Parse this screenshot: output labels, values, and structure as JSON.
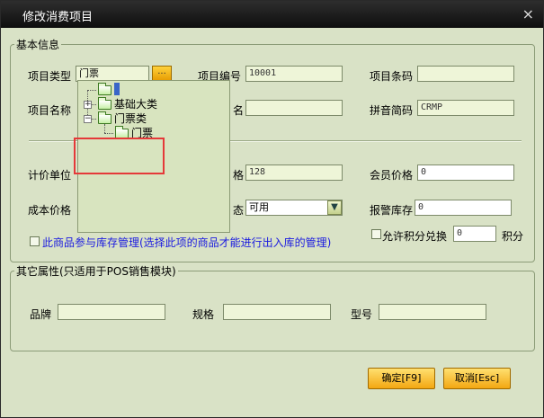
{
  "window": {
    "title": "修改消费项目",
    "close_glyph": "×"
  },
  "basic_info": {
    "legend": "基本信息",
    "item_type": {
      "label": "项目类型",
      "value": "门票",
      "button": "..."
    },
    "item_code": {
      "label": "项目编号",
      "value": "10001"
    },
    "item_barcode": {
      "label": "项目条码",
      "value": ""
    },
    "item_name": {
      "label": "项目名称",
      "hidden_label_tail": "名",
      "value": ""
    },
    "pinyin_code": {
      "label": "拼音简码",
      "value": "CRMP"
    },
    "unit": {
      "label": "计价单位"
    },
    "price": {
      "label_tail": "格",
      "value": "128"
    },
    "member_price": {
      "label": "会员价格",
      "value": "0"
    },
    "cost_price": {
      "label": "成本价格"
    },
    "status": {
      "label_tail": "态",
      "value": "可用"
    },
    "alert_stock": {
      "label": "报警库存",
      "value": "0"
    },
    "stock_manage": {
      "label": "此商品参与库存管理(选择此项的商品才能进行出入库的管理)"
    },
    "points": {
      "label": "允许积分兑换",
      "value": "0",
      "unit": "积分"
    }
  },
  "other_attrs": {
    "legend": "其它属性(只适用于POS销售模块)",
    "brand": {
      "label": "品牌",
      "value": ""
    },
    "spec": {
      "label": "规格",
      "value": ""
    },
    "model": {
      "label": "型号",
      "value": ""
    }
  },
  "buttons": {
    "ok": "确定[F9]",
    "cancel": "取消[Esc]"
  },
  "tree": {
    "root": "",
    "items": [
      {
        "label": "基础大类",
        "toggle": "+"
      },
      {
        "label": "门票类",
        "toggle": "−"
      },
      {
        "label": "门票"
      }
    ]
  },
  "colors": {
    "background": "#d9e2c6",
    "button": "#f3a712",
    "highlight": "#e53939"
  }
}
